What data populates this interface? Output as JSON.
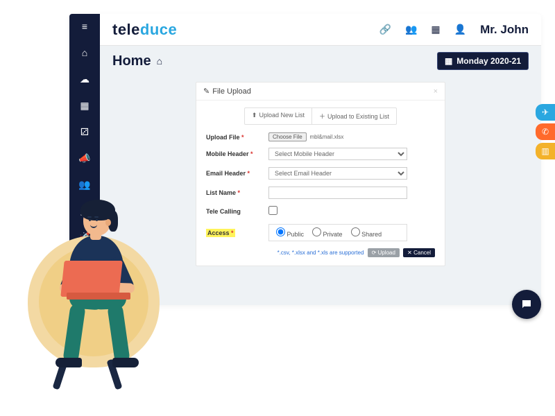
{
  "brand": {
    "part1": "tele",
    "part2": "duce"
  },
  "user_name": "Mr. John",
  "subbar": {
    "title": "Home",
    "date": "Monday 2020-21"
  },
  "panel": {
    "title": "File Upload",
    "tabs": {
      "upload_new": "Upload New List",
      "upload_existing": "Upload to Existing List"
    },
    "labels": {
      "upload_file": "Upload File",
      "mobile_header": "Mobile Header",
      "email_header": "Email Header",
      "list_name": "List Name",
      "tele_calling": "Tele Calling",
      "access": "Access"
    },
    "choose_file": "Choose File",
    "file_name": "mbl&mail.xlsx",
    "mobile_placeholder": "Select Mobile Header",
    "email_placeholder": "Select Email Header",
    "access_options": {
      "public": "Public",
      "private": "Private",
      "shared": "Shared"
    },
    "support_note": "*.csv, *.xlsx and *.xls are supported",
    "buttons": {
      "upload": "Upload",
      "cancel": "Cancel"
    }
  }
}
